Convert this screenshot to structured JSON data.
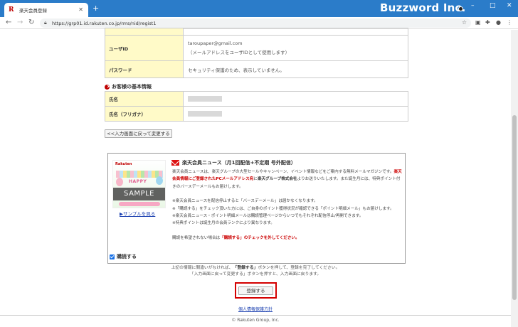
{
  "browser": {
    "tab_title": "楽天会員登録",
    "favicon": "R",
    "new_tab_label": "+",
    "brand_overlay": "Buzzword Inc.",
    "url": "https://grp01.id.rakuten.co.jp/rms/nid/regist1",
    "window_controls": {
      "minimize": "–",
      "maximize": "□",
      "close": "✕"
    }
  },
  "account": {
    "rows": [
      {
        "label": "ユーザID",
        "value": "taroupaper@gmail.com",
        "note": "（メールアドレスをユーザIDとして使用します）"
      },
      {
        "label": "パスワード",
        "value": "セキュリティ保護のため、表示していません。"
      }
    ]
  },
  "basic_info": {
    "heading": "お客様の基本情報",
    "rows": [
      {
        "label": "氏名"
      },
      {
        "label": "氏名（フリガナ）"
      }
    ]
  },
  "back_button_top": "<<入力画面に戻って変更する",
  "newsletter": {
    "title": "楽天会員ニュース（月1回配信+不定期 号外配信）",
    "thumb_logo": "Rakuten",
    "thumb_happy": "HAPPY",
    "thumb_sample": "SAMPLE",
    "sample_link": "▶サンプルを見る",
    "para1_a": "楽天会員ニュースは、楽天グループの大型セールやキャンペーン、イベント情報などをご案内する無料メールマガジンです。",
    "para1_red": "楽天会員情報にご登録されたPCメールアドレス宛",
    "para1_b": "に",
    "para1_bold": "楽天グループ株式会社",
    "para1_c": "よりお送りいたします。また誕生月には、特典ポイント付きのバースデーメールもお届けします。",
    "notes": [
      "※楽天会員ニュースを配信停止すると「バースデーメール」は届かなくなります。",
      "※「購読する」をチェック頂いた方には、ご自身のポイント獲得状況が確認できる「ポイント明細メール」もお届けします。",
      "※楽天会員ニュース・ポイント明細メールは購読管理ページからいつでもそれぞれ配信停止/再開できます。",
      "※特典ポイントは誕生月の会員ランクにより異なります。"
    ],
    "optout_a": "購読を希望されない場合は",
    "optout_red": "「購読する」のチェックを外してください。",
    "subscribe_label": "購読する",
    "subscribed": true
  },
  "confirm_notice": {
    "line1_a": "上記の情報に間違いがなければ、",
    "line1_bold": "「登録する」",
    "line1_b": "ボタンを押して、登録を完了してください。",
    "line2": "「入力画面に戻って変更する」ボタンを押すと、入力画面に戻ります。"
  },
  "register_button": "登録する",
  "privacy_link": "個人情報保護方針",
  "footer": "© Rakuten Group, Inc.",
  "colors": {
    "title_bar": "#2b7cc9",
    "label_cell": "#fffac8",
    "accent_red": "#bf0000",
    "highlight_box": "#d40000"
  }
}
